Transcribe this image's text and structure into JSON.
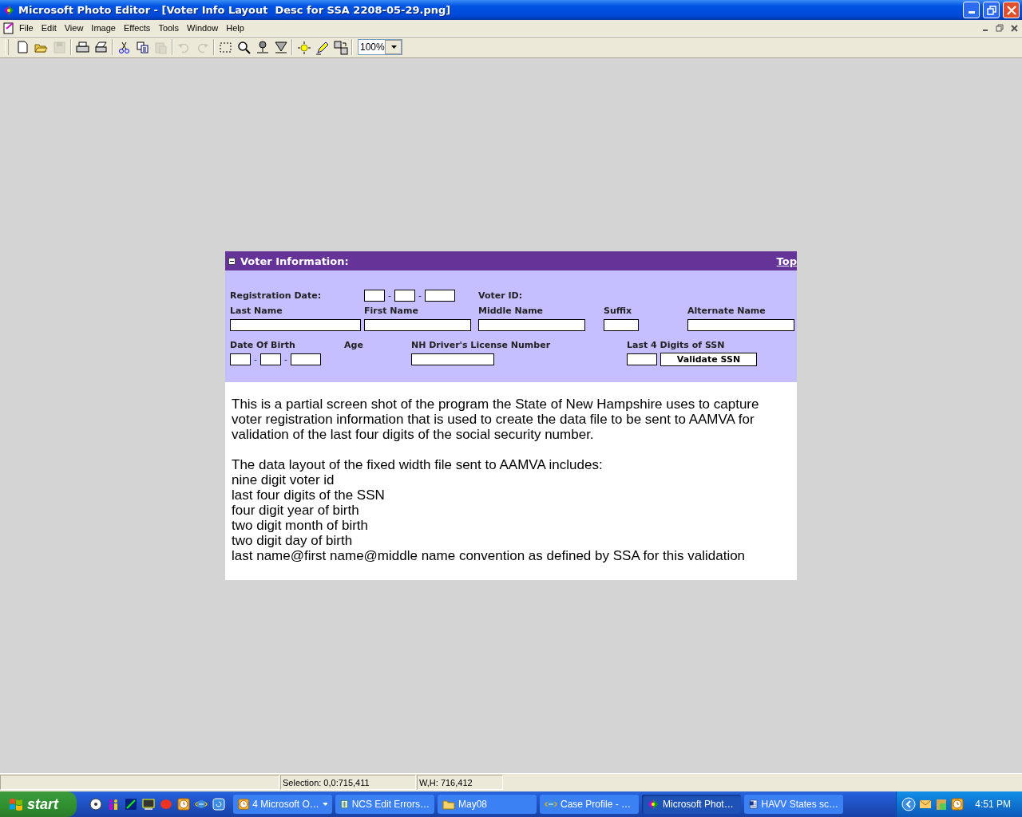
{
  "window": {
    "title": "Microsoft Photo Editor - [Voter Info Layout  Desc for SSA 2208-05-29.png]"
  },
  "menu": [
    "File",
    "Edit",
    "View",
    "Image",
    "Effects",
    "Tools",
    "Window",
    "Help"
  ],
  "toolbar": {
    "buttons": [
      {
        "kind": "new",
        "disabled": false
      },
      {
        "kind": "open",
        "disabled": false
      },
      {
        "kind": "save",
        "disabled": true
      },
      {
        "kind": "sep"
      },
      {
        "kind": "print",
        "disabled": false
      },
      {
        "kind": "scan",
        "disabled": false
      },
      {
        "kind": "sep"
      },
      {
        "kind": "cut",
        "disabled": false
      },
      {
        "kind": "copy",
        "disabled": false
      },
      {
        "kind": "paste",
        "disabled": true
      },
      {
        "kind": "sep"
      },
      {
        "kind": "undo",
        "disabled": true
      },
      {
        "kind": "redo",
        "disabled": true
      },
      {
        "kind": "sep"
      },
      {
        "kind": "select",
        "disabled": false
      },
      {
        "kind": "zoom",
        "disabled": false
      },
      {
        "kind": "pin",
        "disabled": false
      },
      {
        "kind": "funnel",
        "disabled": false
      },
      {
        "kind": "sep"
      },
      {
        "kind": "sun",
        "disabled": false
      },
      {
        "kind": "pencil",
        "disabled": false
      },
      {
        "kind": "convert",
        "disabled": false
      }
    ],
    "zoom": "100%"
  },
  "form": {
    "title": "Voter Information:",
    "link": "Top",
    "registration": {
      "label": "Registration Date:",
      "separators": [
        "-",
        "-"
      ]
    },
    "voter_id": {
      "label": "Voter ID:"
    },
    "name_fields": [
      "Last Name",
      "First Name",
      "Middle Name",
      "Suffix",
      "Alternate Name"
    ],
    "date_of_birth": {
      "label": "Date Of Birth",
      "separators": [
        "-",
        "-"
      ]
    },
    "age": {
      "label": "Age"
    },
    "license": {
      "label": "NH Driver's License Number"
    },
    "ssn": {
      "label": "Last 4 Digits of SSN",
      "button": "Validate SSN"
    }
  },
  "description": {
    "paragraph": "This is a partial screen shot of the program the State of New Hampshire uses to capture voter registration information that is used to create the data file to be sent to AAMVA for validation of the last four digits of the social security number.",
    "lines": [
      "The data layout of the fixed width file sent to AAMVA includes:",
      "nine digit voter id",
      "last four digits of the SSN",
      "four digit year of birth",
      "two digit month of birth",
      "two digit day of birth",
      "last name@first name@middle name convention as defined by SSA for this validation"
    ]
  },
  "status_bar": {
    "selection": "Selection: 0,0:715,411",
    "size": "W,H: 716,412"
  },
  "taskbar": {
    "start": "start",
    "tasks": [
      {
        "label": "4 Microsoft O…",
        "kind": "clock",
        "group": true,
        "selected": false
      },
      {
        "label": "NCS Edit Errors…",
        "kind": "sheet",
        "group": false,
        "selected": false
      },
      {
        "label": "May08",
        "kind": "folder",
        "group": false,
        "selected": false
      },
      {
        "label": "Case Profile - …",
        "kind": "browser",
        "group": false,
        "selected": false
      },
      {
        "label": "Microsoft Phot…",
        "kind": "photo",
        "group": false,
        "selected": true
      },
      {
        "label": "HAVV States sc…",
        "kind": "doc",
        "group": false,
        "selected": false
      }
    ],
    "time": "4:51 PM"
  }
}
